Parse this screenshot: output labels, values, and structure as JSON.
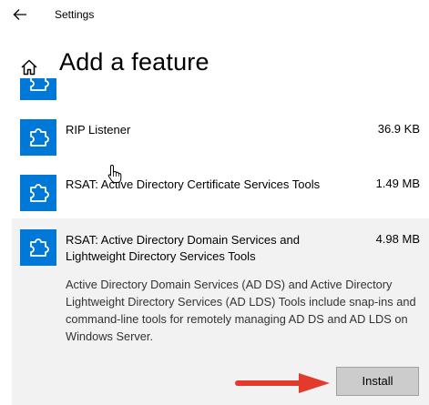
{
  "window": {
    "title": "Settings"
  },
  "page": {
    "title": "Add a feature"
  },
  "features": [
    {
      "name": "RIP Listener",
      "size": "36.9 KB"
    },
    {
      "name": "RSAT: Active Directory Certificate Services Tools",
      "size": "1.49 MB"
    },
    {
      "name_line1": "RSAT: Active Directory Domain Services and",
      "name_line2": "Lightweight Directory Services Tools",
      "size": "4.98 MB",
      "description": "Active Directory Domain Services (AD DS) and Active Directory Lightweight Directory Services (AD LDS) Tools include snap-ins and command-line tools for remotely managing AD DS and AD LDS on Windows Server.",
      "install_label": "Install"
    }
  ],
  "colors": {
    "accent": "#0078d7",
    "selected_bg": "#f2f2f2",
    "annotation_arrow": "#e23b2e"
  },
  "icons": {
    "back": "back-arrow-icon",
    "home": "home-icon",
    "feature": "puzzle-piece-icon",
    "cursor": "hand-pointer-icon"
  }
}
